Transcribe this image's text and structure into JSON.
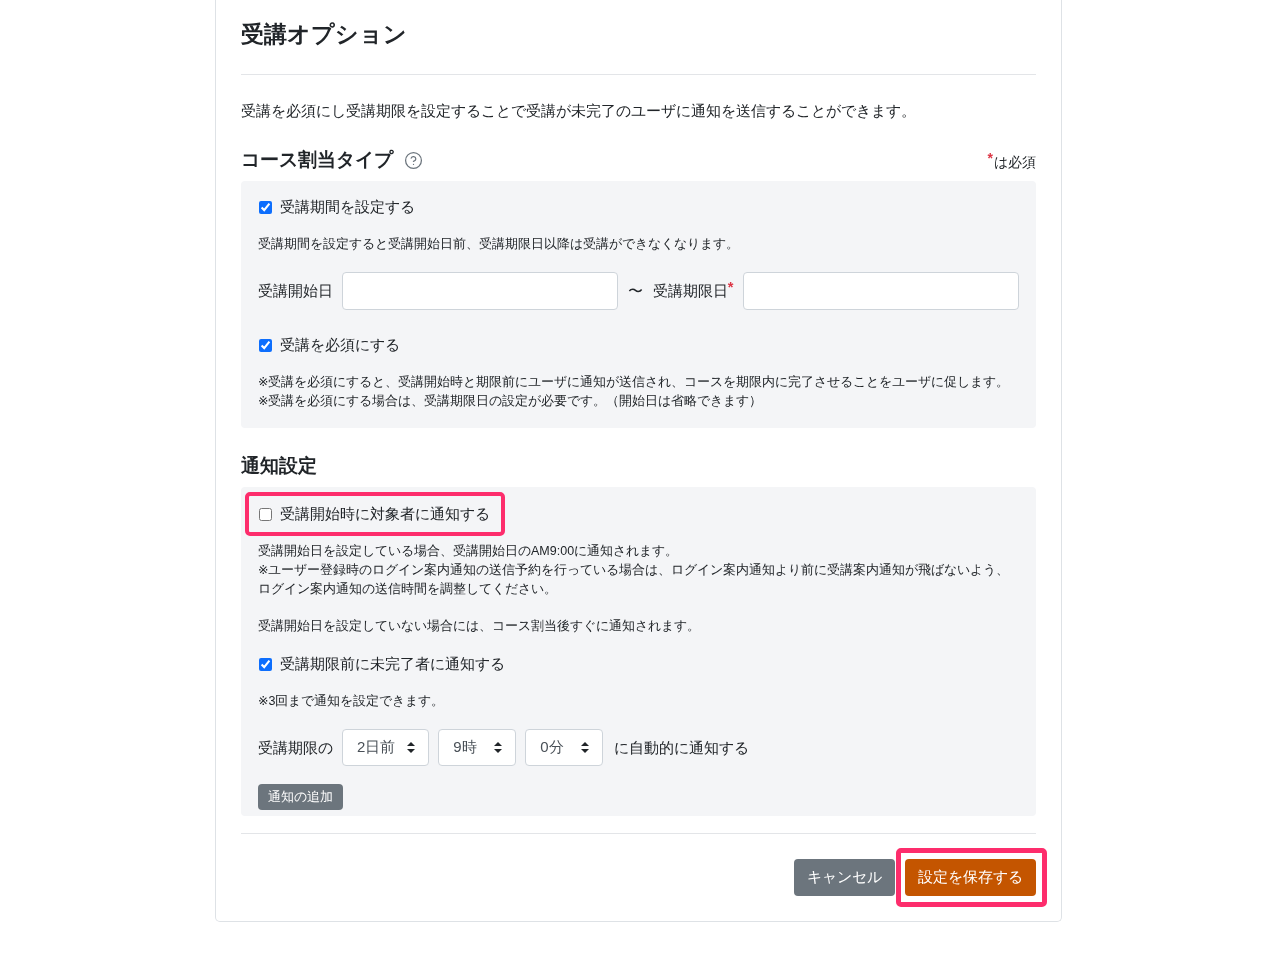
{
  "page": {
    "title": "受講オプション",
    "description": "受講を必須にし受講期限を設定することで受講が未完了のユーザに通知を送信することができます。"
  },
  "assignment": {
    "heading": "コース割当タイプ",
    "required_legend": {
      "mark": "*",
      "text": "は必須"
    },
    "items": [
      {
        "kind": "checkbox",
        "label": "受講期間を設定する",
        "checked": true,
        "highlighted": false
      },
      {
        "kind": "note",
        "lines": [
          "受講期間を設定すると受講開始日前、受講期限日以降は受講ができなくなります。"
        ]
      },
      {
        "kind": "date_range",
        "fields": [
          {
            "label": "受講開始日"
          },
          {
            "label": "受講期限日",
            "required_mark": "*"
          }
        ],
        "separator": "〜"
      },
      {
        "kind": "checkbox",
        "label": "受講を必須にする",
        "checked": true,
        "highlighted": false
      },
      {
        "kind": "note",
        "lines": [
          "※受講を必須にすると、受講開始時と期限前にユーザに通知が送信され、コースを期限内に完了させることをユーザに促します。",
          "※受講を必須にする場合は、受講期限日の設定が必要です。（開始日は省略できます）"
        ]
      }
    ]
  },
  "notification": {
    "heading": "通知設定",
    "items": [
      {
        "kind": "checkbox",
        "label": "受講開始時に対象者に通知する",
        "checked": false,
        "highlighted": true
      },
      {
        "kind": "note",
        "lines": [
          "受講開始日を設定している場合、受講開始日のAM9:00に通知されます。",
          "※ユーザー登録時のログイン案内通知の送信予約を行っている場合は、ログイン案内通知より前に受講案内通知が飛ばないよう、",
          "ログイン案内通知の送信時間を調整してください。"
        ]
      },
      {
        "kind": "note",
        "lines": [
          "受講開始日を設定していない場合には、コース割当後すぐに通知されます。"
        ]
      },
      {
        "kind": "checkbox",
        "label": "受講期限前に未完了者に通知する",
        "checked": true,
        "highlighted": false
      },
      {
        "kind": "note",
        "lines": [
          "※3回まで通知を設定できます。"
        ]
      },
      {
        "kind": "schedule",
        "prefix": "受講期限の",
        "selects": [
          "2日前",
          "9時",
          "0分"
        ],
        "suffix": "に自動的に通知する"
      },
      {
        "kind": "button",
        "label": "通知の追加"
      }
    ]
  },
  "footer": {
    "buttons": [
      {
        "label": "キャンセル",
        "kind": "secondary",
        "highlighted": false
      },
      {
        "label": "設定を保存する",
        "kind": "primary",
        "highlighted": true
      }
    ]
  }
}
